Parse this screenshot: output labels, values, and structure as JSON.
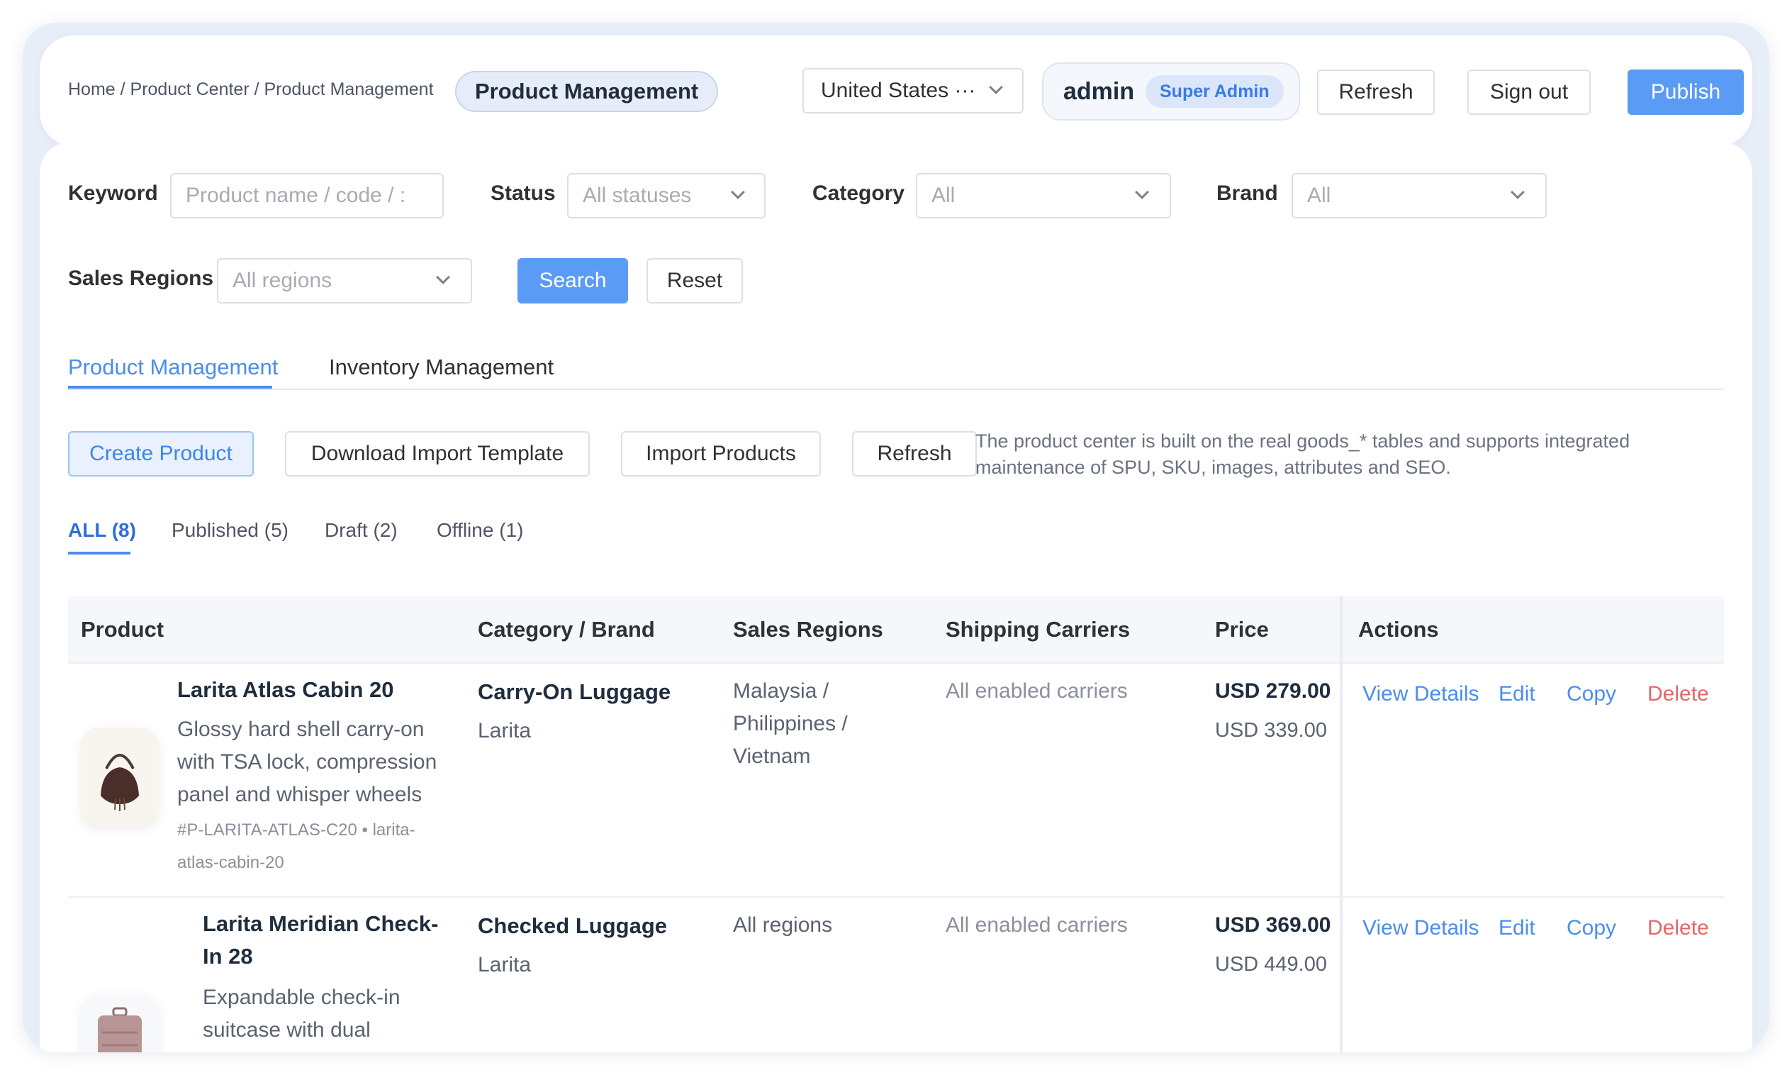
{
  "header": {
    "breadcrumb": "Home / Product Center / Product Management",
    "page_pill": "Product Management",
    "country": "United States ···",
    "user_name": "admin",
    "user_role": "Super Admin",
    "refresh_label": "Refresh",
    "signout_label": "Sign out",
    "publish_label": "Publish"
  },
  "filters": {
    "keyword_label": "Keyword",
    "keyword_placeholder": "Product name / code / :",
    "status_label": "Status",
    "status_value": "All statuses",
    "category_label": "Category",
    "category_value": "All",
    "brand_label": "Brand",
    "brand_value": "All",
    "regions_label": "Sales Regions",
    "regions_value": "All regions",
    "search_label": "Search",
    "reset_label": "Reset"
  },
  "tabs": [
    {
      "label": "Product Management",
      "active": true
    },
    {
      "label": "Inventory Management",
      "active": false
    }
  ],
  "toolbar": {
    "create_label": "Create Product",
    "download_label": "Download Import Template",
    "import_label": "Import Products",
    "refresh_label": "Refresh",
    "note": "The product center is built on the real goods_* tables and supports integrated maintenance of SPU, SKU, images, attributes and SEO."
  },
  "status_tabs": [
    {
      "label": "ALL (8)",
      "active": true
    },
    {
      "label": "Published (5)",
      "active": false
    },
    {
      "label": "Draft (2)",
      "active": false
    },
    {
      "label": "Offline (1)",
      "active": false
    }
  ],
  "table": {
    "columns": [
      "Product",
      "Category / Brand",
      "Sales Regions",
      "Shipping Carriers",
      "Price",
      "Actions"
    ],
    "action_labels": [
      "View Details",
      "Edit",
      "Copy",
      "Delete"
    ],
    "rows": [
      {
        "name": "Larita Atlas Cabin 20",
        "description": "Glossy hard shell carry-on with TSA lock, compression panel and whisper wheels",
        "meta": "#P-LARITA-ATLAS-C20 • larita-atlas-cabin-20",
        "category": "Carry-On Luggage",
        "brand": "Larita",
        "regions": "Malaysia / Philippines / Vietnam",
        "carriers": "All enabled carriers",
        "price": "USD 279.00",
        "original_price": "USD 339.00",
        "thumb_icon": "handbag-icon"
      },
      {
        "name": "Larita Meridian Check-In 28",
        "description": "Expandable check-in suitcase with dual",
        "category": "Checked Luggage",
        "brand": "Larita",
        "regions": "All regions",
        "carriers": "All enabled carriers",
        "price": "USD 369.00",
        "original_price": "USD 449.00",
        "thumb_icon": "suitcase-icon"
      }
    ]
  },
  "colors": {
    "primary": "#5a9bf5",
    "link": "#4a8df0",
    "danger": "#e66767",
    "frame": "#e8eef8"
  }
}
